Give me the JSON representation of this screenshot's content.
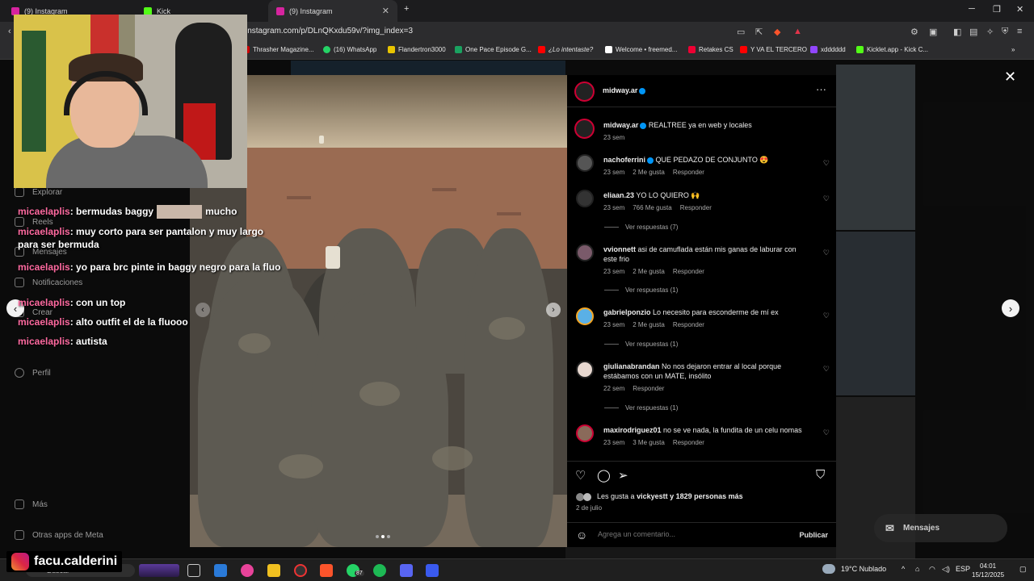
{
  "browser": {
    "tabs": [
      {
        "label": "(9) Instagram"
      },
      {
        "label": "Kick"
      },
      {
        "label": "(9) Instagram"
      }
    ],
    "url": "instagram.com/p/DLnQKxdu59v/?img_index=3",
    "bookmarks": [
      "Thrasher Magazine...",
      "(16) WhatsApp",
      "Flandertron3000",
      "One Pace Episode G...",
      "¿Lo intentaste?",
      "Welcome • freemed...",
      "Retakes CS",
      "Y VA EL TERCERO",
      "xdddddd",
      "Kicklet.app - Kick C..."
    ],
    "badge": "8"
  },
  "sidebar": {
    "items": [
      "Explorar",
      "Reels",
      "Mensajes",
      "Notificaciones",
      "Crear",
      "Perfil",
      "Más",
      "Otras apps de Meta"
    ]
  },
  "post": {
    "author": "midway.ar",
    "caption_user": "midway.ar",
    "caption": "REALTREE ya en web y locales",
    "caption_time": "23 sem",
    "comments": [
      {
        "user": "nachoferrini",
        "verified": true,
        "text": "QUE PEDAZO DE CONJUNTO 😍",
        "time": "23 sem",
        "likes": "2 Me gusta",
        "reply": "Responder"
      },
      {
        "user": "eliaan.23",
        "verified": false,
        "text": "YO LO QUIERO 🙌",
        "time": "23 sem",
        "likes": "766 Me gusta",
        "reply": "Responder",
        "replies": "Ver respuestas (7)"
      },
      {
        "user": "vvionnett",
        "verified": false,
        "text": "asi de camuflada están mis ganas de laburar con este frio",
        "time": "23 sem",
        "likes": "2 Me gusta",
        "reply": "Responder",
        "replies": "Ver respuestas (1)"
      },
      {
        "user": "gabrielponzio",
        "verified": false,
        "text": "Lo necesito para esconderme de mí ex",
        "time": "23 sem",
        "likes": "2 Me gusta",
        "reply": "Responder",
        "replies": "Ver respuestas (1)"
      },
      {
        "user": "giulianabrandan",
        "verified": false,
        "text": "No nos dejaron entrar al local porque estábamos con un MATE, insólito",
        "time": "22 sem",
        "likes": "",
        "reply": "Responder",
        "replies": "Ver respuestas (1)"
      },
      {
        "user": "maxirodriguez01",
        "verified": false,
        "text": "no se ve nada, la fundita de un celu nomas",
        "time": "23 sem",
        "likes": "3 Me gusta",
        "reply": "Responder"
      }
    ],
    "likes_prefix": "Les gusta a",
    "likes_user": "vickyestt",
    "likes_suffix": "y 1829 personas más",
    "date": "2 de julio",
    "comment_placeholder": "Agrega un comentario...",
    "publish_label": "Publicar"
  },
  "messages_label": "Mensajes",
  "stream": {
    "chat": [
      {
        "user": "micaelaplis",
        "text": ": bermudas baggy",
        "after": "mucho"
      },
      {
        "user": "micaelaplis",
        "text": ": muy corto para ser pantalon y muy largo para ser bermuda"
      },
      {
        "user": "micaelaplis",
        "text": ": yo para brc pinte in baggy negro para la fluo"
      },
      {
        "user": "micaelaplis",
        "text": ": con un top"
      },
      {
        "user": "micaelaplis",
        "text": ": alto outfit el de la fluooo"
      },
      {
        "user": "micaelaplis",
        "text": ": autista"
      }
    ],
    "streamer_name": "facu.calderini"
  },
  "taskbar": {
    "search": "Buscar",
    "whatsapp_badge": "87",
    "weather": "19°C  Nublado",
    "lang": "ESP",
    "time": "04:01",
    "date": "15/12/2025"
  }
}
